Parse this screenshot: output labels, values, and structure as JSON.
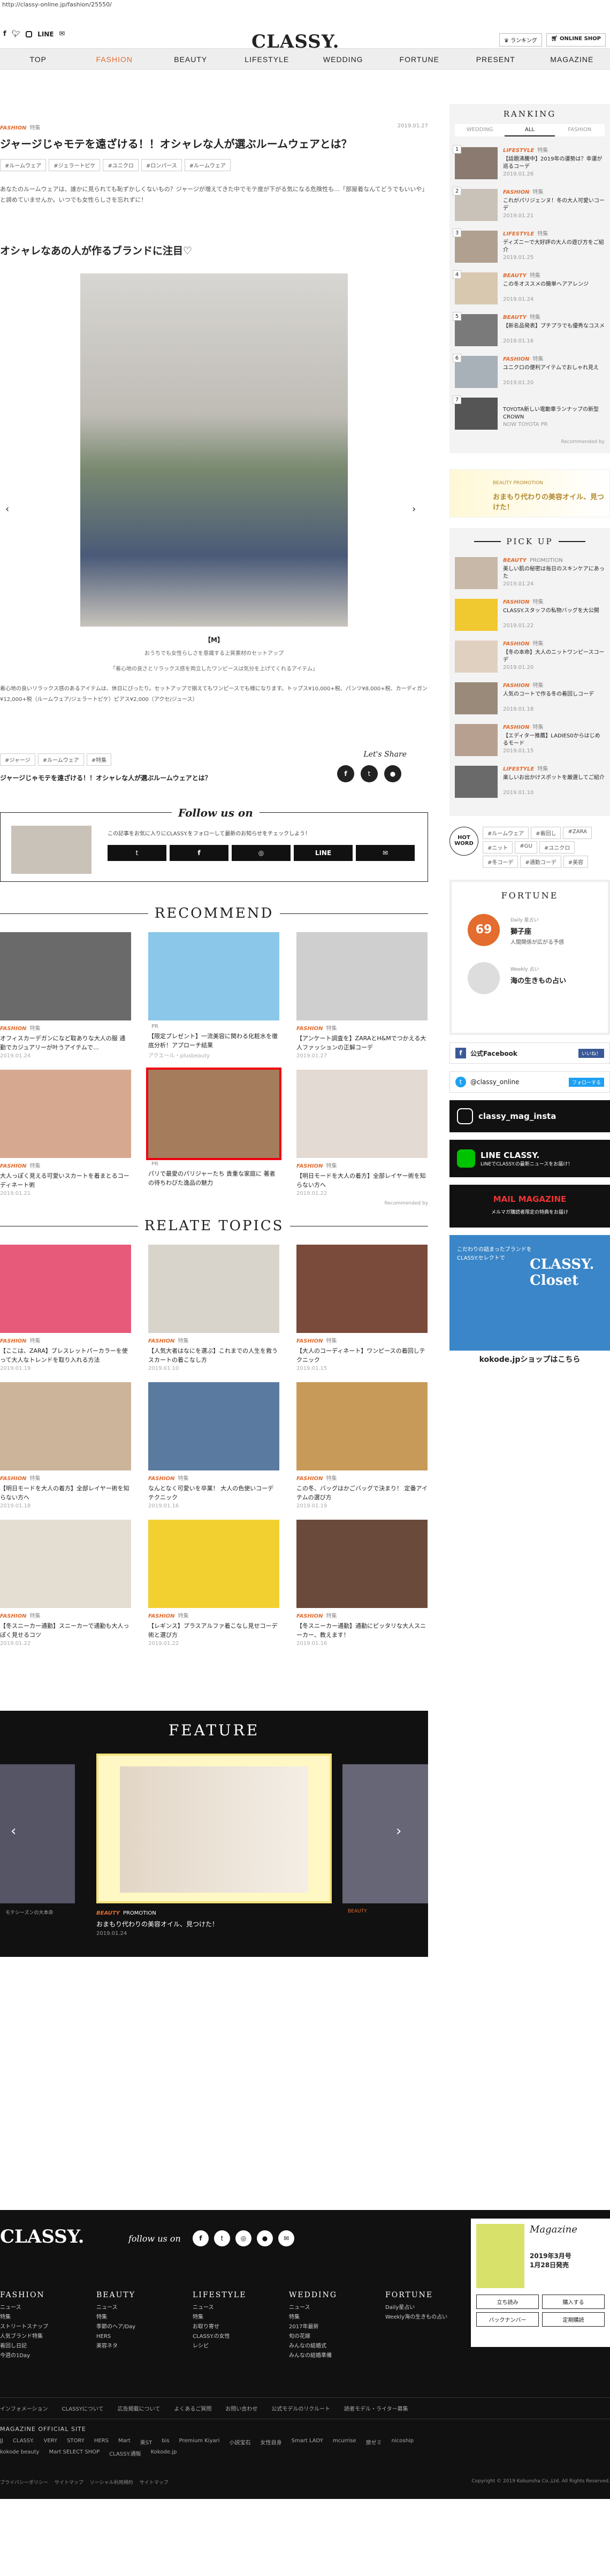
{
  "url": "http://classy-online.jp/fashion/25550/",
  "header": {
    "logo": "CLASSY.",
    "line_label": "LINE",
    "btn_ranking": "ランキング",
    "btn_shop": "ONLINE SHOP"
  },
  "nav": [
    "TOP",
    "FASHION",
    "BEAUTY",
    "LIFESTYLE",
    "WEDDING",
    "FORTUNE",
    "PRESENT",
    "MAGAZINE"
  ],
  "article": {
    "category": "FASHION",
    "subcategory": "特集",
    "date": "2019.01.27",
    "title": "ジャージじゃモテを遠ざける！！オシャレな人が選ぶルームウェアとは？",
    "tags": [
      "#ルームウェア",
      "#ジェラートピケ",
      "#ユニクロ",
      "#ロンパース",
      "#ルームウェア"
    ],
    "intro": "あなたのルームウェアは、誰かに見られても恥ずかしくないもの？ジャージが増えてきた中でモテ度が下がる気になる危険性も…「部屋着なんてどうでもいいや」と諦めていませんか。いつでも女性らしさを忘れずに！",
    "heading": "オシャレなあの人が作るブランドに注目♡",
    "caption_label": "【M】",
    "caption_line1": "おうちでも女性らしさを意識する上質素材のセットアップ",
    "caption_line2": "「着心地の良さとリラックス感を両立したワンピースは気分を上げてくれるアイテム」",
    "body": "着心地の良いリラックス感のあるアイテムは、休日にぴったり。セットアップで揃えてもワンピースでも様になります。トップス¥10,000+税、パンツ¥8,000+税、カーディガン¥12,000+税（ルームウェア/ジェラートピケ）ピアス¥2,000（アクセ/ジュース）",
    "bottom_tags": [
      "#ジャージ",
      "#ルームウェア",
      "#特集"
    ],
    "bottom_title": "ジャージじゃモテを遠ざける！！オシャレな人が選ぶルームウェアとは？",
    "share_label": "Let's Share"
  },
  "follow": {
    "title": "Follow us on",
    "text": "この記事をお気に入りにCLASSY.をフォローして最新のお知らせをチェックしよう！",
    "line": "LINE"
  },
  "recommend": {
    "title": "RECOMMEND",
    "credit": "Recommended by",
    "items": [
      {
        "cat": "FASHION",
        "sub": "特集",
        "title": "オフィスカーデガンになど取ありな大人の服 通勤でカジュアリーが叶うアイテムで…",
        "date": "2019.01.24",
        "color": "#6a6a6a"
      },
      {
        "cat": "",
        "sub": "PR",
        "title": "【限定プレゼント】一流美容に関わる化粧水を徹底分析！アプローチ結果",
        "date": "アクエール・plusbeauty",
        "color": "#8ac7e8"
      },
      {
        "cat": "FASHION",
        "sub": "特集",
        "title": "【アンケート調査を】ZARAとH&Mでつかえる大人ファッションの正解コーデ",
        "date": "2019.01.27",
        "color": "#cfcfcf"
      },
      {
        "cat": "FASHION",
        "sub": "特集",
        "title": "大人っぽく見える可愛いスカートを着まとるコーディネート術",
        "date": "2019.01.21",
        "color": "#d6a890"
      },
      {
        "cat": "",
        "sub": "PR",
        "title": "パリで最愛のパリジャーたち 貴重な家庭に 著者の待ちわびた逸品の魅力",
        "date": "",
        "color": "#a57c5c"
      },
      {
        "cat": "FASHION",
        "sub": "特集",
        "title": "【明日モードを大人の着方】全部レイヤー術を知らない方へ",
        "date": "2019.01.22",
        "color": "#e2dad3"
      }
    ]
  },
  "relate": {
    "title": "RELATE TOPICS",
    "items": [
      {
        "cat": "FASHION",
        "sub": "特集",
        "title": "【ここは、ZARA】ブレスレットパーカラーを使って大人なトレンドを取り入れる方法",
        "date": "2019.01.19",
        "color": "#e85a7a"
      },
      {
        "cat": "FASHION",
        "sub": "特集",
        "title": "【人気大者はなにを選ぶ】これまでの人生を救うスカートの着こなし方",
        "date": "2019.01.10",
        "color": "#d8d4cc"
      },
      {
        "cat": "FASHION",
        "sub": "特集",
        "title": "【大人のコーディネート】ワンピースの着回しテクニック",
        "date": "2019.01.15",
        "color": "#7a4a3a"
      },
      {
        "cat": "FASHION",
        "sub": "特集",
        "title": "【明日モードを大人の着方】全部レイヤー術を知らない方へ",
        "date": "2019.01.18",
        "color": "#cbb49a"
      },
      {
        "cat": "FASHION",
        "sub": "特集",
        "title": "なんとなく可愛いを卒業！ 大人の色使いコーデテクニック",
        "date": "2019.01.16",
        "color": "#5a7aa0"
      },
      {
        "cat": "FASHION",
        "sub": "特集",
        "title": "この冬、バッグはかごバッグで決まり！ 定番アイテムの選び方",
        "date": "2019.01.19",
        "color": "#c89a5a"
      },
      {
        "cat": "FASHION",
        "sub": "特集",
        "title": "【冬スニーカー通勤】スニーカーで通勤も大人っぽく見せるコツ",
        "date": "2019.01.22",
        "color": "#e4ddd2"
      },
      {
        "cat": "FASHION",
        "sub": "特集",
        "title": "【レギンス】プラスアルファ着こなし見せコーデ術と選び方",
        "date": "2019.01.22",
        "color": "#f2d030"
      },
      {
        "cat": "FASHION",
        "sub": "特集",
        "title": "【冬スニーカー通勤】通勤にピッタリな大人スニーカー、教えます！",
        "date": "2019.01.16",
        "color": "#6a4a3a"
      }
    ]
  },
  "feature": {
    "title": "FEATURE",
    "cat": "BEAUTY",
    "sub": "PROMOTION",
    "headline": "おまもり代わりの美容オイル、見つけた！",
    "date": "2019.01.24",
    "left_caption": "モテシーズンの大本命",
    "right_caption": "BEAUTY"
  },
  "sidebar": {
    "ranking_title": "RANKING",
    "ranking_tabs": [
      "WEDDING",
      "ALL",
      "FASHION"
    ],
    "ranking": [
      {
        "cat": "LIFESTYLE",
        "sub": "特集",
        "title": "【話題沸騰中】2019年の運勢は？幸運が巡るコーデ",
        "date": "2019.01.26"
      },
      {
        "cat": "FASHION",
        "sub": "特集",
        "title": "これがパリジェンヌ！冬の大人可愛いコーデ",
        "date": "2019.01.21"
      },
      {
        "cat": "LIFESTYLE",
        "sub": "特集",
        "title": "ディズニーで大好評の大人の遊び方をご紹介",
        "date": "2019.01.25"
      },
      {
        "cat": "BEAUTY",
        "sub": "特集",
        "title": "この冬オススメの簡単ヘアアレンジ",
        "date": "2019.01.24"
      },
      {
        "cat": "BEAUTY",
        "sub": "特集",
        "title": "【新名品発表】プチプラでも優秀なコスメ",
        "date": "2019.01.16"
      },
      {
        "cat": "FASHION",
        "sub": "特集",
        "title": "ユニクロの便利アイテムでおしゃれ見え",
        "date": "2019.01.20"
      },
      {
        "cat": "",
        "sub": "",
        "title": "TOYOTA新しい電動車ランナップの新型CROWN",
        "date": "NOW TOYOTA PR"
      }
    ],
    "ranking_credit": "Recommended by",
    "ad1_text": "おまもり代わりの美容オイル、見つけた！",
    "ad1_label": "BEAUTY PROMOTION",
    "pickup_title": "PICK UP",
    "pickup": [
      {
        "cat": "BEAUTY",
        "sub": "PROMOTION",
        "title": "美しい肌の秘密は毎日のスキンケアにあった",
        "date": "2019.01.24"
      },
      {
        "cat": "FASHION",
        "sub": "特集",
        "title": "CLASSY.スタッフの私物バッグを大公開",
        "date": "2019.01.22"
      },
      {
        "cat": "FASHION",
        "sub": "特集",
        "title": "【冬の本命】大人のニットワンピースコーデ",
        "date": "2019.01.20"
      },
      {
        "cat": "FASHION",
        "sub": "特集",
        "title": "人気のコートで作る冬の着回しコーデ",
        "date": "2019.01.18"
      },
      {
        "cat": "FASHION",
        "sub": "特集",
        "title": "【エディター推薦】LADIES0からはじめるモード",
        "date": "2019.01.15"
      },
      {
        "cat": "LIFESTYLE",
        "sub": "特集",
        "title": "楽しいお出かけスポットを厳選してご紹介",
        "date": "2019.01.10"
      }
    ],
    "hot_label": "HOT WORD",
    "hot_words": [
      "#ルームウェア",
      "#着回し",
      "#ZARA",
      "#ニット",
      "#GU",
      "#ユニクロ",
      "#冬コーデ",
      "#通勤コーデ",
      "#美容"
    ],
    "fortune_title": "FORTUNE",
    "fortune_rank": "69",
    "fortune_daily": "Daily 星占い",
    "fortune_sign": "獅子座",
    "fortune_sign_jp": "獅子座",
    "fortune_text": "人間関係が広がる予感",
    "fortune_weekly": "Weekly 占い",
    "fortune_weekly_title": "海の生きもの占い",
    "fb_label": "公式Facebook",
    "fb_btn": "いいね！",
    "tw_label": "@classy_online",
    "tw_btn": "フォローする",
    "ig_label": "classy_mag_insta",
    "line_label": "LINE CLASSY.",
    "line_sub": "LINEでCLASSY.の最新ニュースをお届け！",
    "mail_label": "MAIL MAGAZINE",
    "mail_sub": "メルマガ購読者限定の特典をお届け",
    "closet_title": "CLASSY. Closet",
    "closet_sub": "こだわりの詰まったブランドをCLASSY.セレクトで",
    "closet_link": "kokode.jpショップはこちら"
  },
  "footer": {
    "logo": "CLASSY.",
    "follow": "follow us on",
    "cols": [
      {
        "title": "FASHION",
        "items": [
          "ニュース",
          "特集",
          "ストリートスナップ",
          "人気ブランド特集",
          "着回し日記",
          "今週の1Day"
        ]
      },
      {
        "title": "BEAUTY",
        "items": [
          "ニュース",
          "特集",
          "季節のヘア/Day",
          "HERS",
          "美容ネタ"
        ]
      },
      {
        "title": "LIFESTYLE",
        "items": [
          "ニュース",
          "特集",
          "お取り寄せ",
          "CLASSY.の女性",
          "レシピ"
        ]
      },
      {
        "title": "WEDDING",
        "items": [
          "ニュース",
          "特集",
          "2017年最新",
          "旬の花嫁",
          "みんなの結婚式",
          "みんなの結婚準備"
        ]
      },
      {
        "title": "FORTUNE",
        "items": [
          "Daily星占い",
          "Weekly海の生きもの占い"
        ]
      }
    ],
    "magazine_label": "Magazine",
    "magazine_price": "2019年3月号",
    "magazine_date": "1月28日発売",
    "magazine_btn1": "立ち読み",
    "magazine_btn2": "購入する",
    "magazine_btn3": "バックナンバー",
    "magazine_btn4": "定期購読",
    "links": [
      "インフォメーション",
      "CLASSYについて",
      "広告掲載について",
      "よくあるご質問",
      "お問い合わせ",
      "公式モデルのリクルート",
      "読者モデル・ライター募集"
    ],
    "official_title": "MAGAZINE OFFICIAL SITE",
    "official_sites": [
      "JJ",
      "CLASSY.",
      "VERY",
      "STORY",
      "HERS",
      "Mart",
      "美ST",
      "bis",
      "Premium Kiyari",
      "小説宝石",
      "女性自身",
      "Smart LADY",
      "mcurrise",
      "旅ゼミ",
      "nicoship",
      "kokode beauty",
      "Mart SELECT SHOP",
      "CLASSY.通販",
      "Kokode.jp"
    ],
    "bottom_links": [
      "プライバシーポリシー",
      "サイトマップ",
      "ソーシャル利用規約",
      "サイトマップ"
    ],
    "copyright": "Copyright © 2019 Kobunsha Co.,Ltd. All Rights Reserved."
  }
}
